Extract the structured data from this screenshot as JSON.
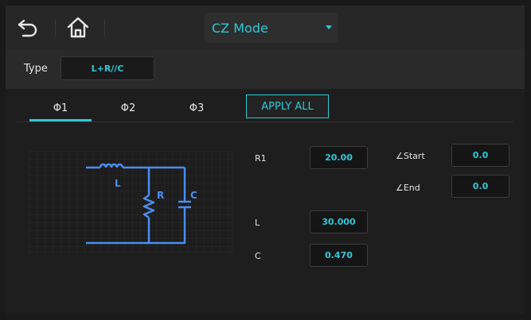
{
  "topbar": {
    "mode_value": "CZ Mode"
  },
  "type": {
    "label": "Type",
    "value": "L+R//C"
  },
  "tabs": [
    {
      "label": "Φ1",
      "active": true
    },
    {
      "label": "Φ2",
      "active": false
    },
    {
      "label": "Φ3",
      "active": false
    }
  ],
  "apply_all_label": "APPLY ALL",
  "circuit": {
    "labels": {
      "inductor": "L",
      "resistor": "R",
      "capacitor": "C"
    }
  },
  "params": {
    "r1": {
      "label": "R1",
      "value": "20.00"
    },
    "l": {
      "label": "L",
      "value": "30.000"
    },
    "c": {
      "label": "C",
      "value": "0.470"
    },
    "start": {
      "label": "∠Start",
      "value": "0.0"
    },
    "end": {
      "label": "∠End",
      "value": "0.0"
    }
  },
  "colors": {
    "accent": "#2ec9d8",
    "circuit": "#4c8df2"
  },
  "icons": [
    "back-icon",
    "home-icon",
    "chevron-down-icon"
  ]
}
